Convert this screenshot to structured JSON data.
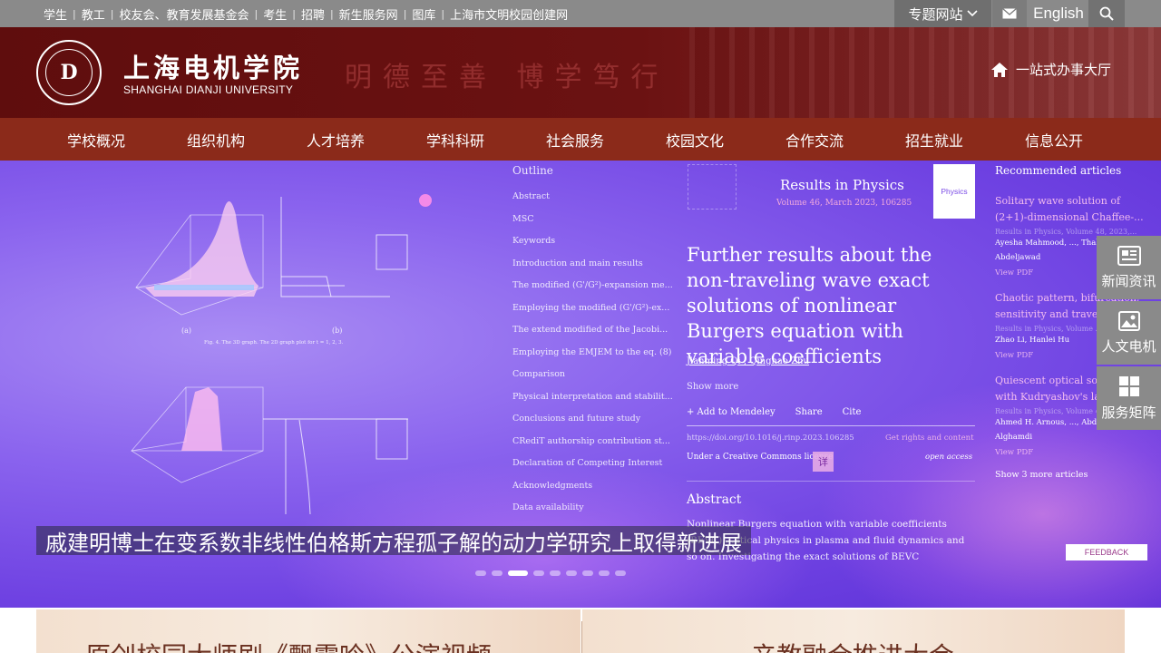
{
  "topbar": {
    "links": [
      "学生",
      "教工",
      "校友会、教育发展基金会",
      "考生",
      "招聘",
      "新生服务网",
      "图库",
      "上海市文明校园创建网"
    ],
    "special_sites": "专题网站",
    "english": "English"
  },
  "header": {
    "school_cn": "上海电机学院",
    "school_en": "SHANGHAI DIANJI UNIVERSITY",
    "motto": "明德至善  博学笃行",
    "one_stop": "一站式办事大厅"
  },
  "nav": [
    "学校概况",
    "组织机构",
    "人才培养",
    "学科科研",
    "社会服务",
    "校园文化",
    "合作交流",
    "招生就业",
    "信息公开"
  ],
  "hero": {
    "outline_title": "Outline",
    "outline": [
      "Abstract",
      "MSC",
      "Keywords",
      "Introduction and main results",
      "The modified (G'/G²)-expansion me...",
      "Employing the modified (G'/G²)-ex...",
      "The extend modified of the Jacobi...",
      "Employing the EMJEM to the eq. (8)",
      "Comparison",
      "Physical interpretation and stabilit...",
      "Conclusions and future study",
      "CRediT authorship contribution st...",
      "Declaration of Competing Interest",
      "Acknowledgments",
      "Data availability"
    ],
    "journal": "Results in Physics",
    "volume": "Volume 46, March 2023, 106285",
    "journal_logo": "Physics",
    "paper_title": "Further results about the non-traveling wave exact solutions of nonlinear Burgers equation with variable coefficients",
    "authors": "Jianming Qi  ,  Qinghao Zhu",
    "show_more": "Show more",
    "actions": [
      "+ Add to Mendeley",
      "Share",
      "Cite"
    ],
    "doi": "https://doi.org/10.1016/j.rinp.2023.106285",
    "rights": "Get rights and content",
    "license": "Under a Creative Commons license",
    "open_access": "open access",
    "detail_badge": "详",
    "abstract_heading": "Abstract",
    "abstract_text": "Nonlinear Burgers equation with variable coefficients (BEVC) ...atical physics in plasma and fluid dynamics and so on. Investigating the exact solutions of BEVC",
    "recommended_title": "Recommended articles",
    "recommended": [
      {
        "title": "Solitary wave solution of (2+1)-dimensional Chaffee-...",
        "meta": "Results in Physics, Volume 48, 2023,...",
        "authors": "Ayesha Mahmood, ..., Thabet Abdeljawad",
        "view": "View PDF"
      },
      {
        "title": "Chaotic pattern, bifurcation, sensitivity and traveling...",
        "meta": "Results in Physics, Volume ...",
        "authors": "Zhao Li, Hanlei Hu",
        "view": "View PDF"
      },
      {
        "title": "Quiescent optical solitons with Kudryashov's law...",
        "meta": "Results in Physics, Volume 47, 2023,...",
        "authors": "Ahmed H. Arnous, ..., Abdullah A. Alghamdi",
        "view": "View PDF"
      }
    ],
    "show_more_articles": "Show 3 more articles",
    "caption": "戚建明博士在变系数非线性伯格斯方程孤子解的动力学研究上取得新进展",
    "feedback": "FEEDBACK",
    "slide_count": 9,
    "active_slide": 3,
    "fig_caption": "Fig. 4. The 3D graph. The 2D graph plot for t = 1, 2, 3.",
    "plot_labels": {
      "a": "(a)",
      "b": "(b)"
    }
  },
  "side_panel": [
    "新闻资讯",
    "人文电机",
    "服务矩阵"
  ],
  "banners": [
    "原创校园大师剧《飘零吟》公演视频",
    "产教融合推进大会"
  ],
  "colors": {
    "header_bg": "#6b1212",
    "nav_bg": "#8b2a1a",
    "topbar_bg": "#8a8a8a",
    "hero_bg": "#7a52ea"
  }
}
